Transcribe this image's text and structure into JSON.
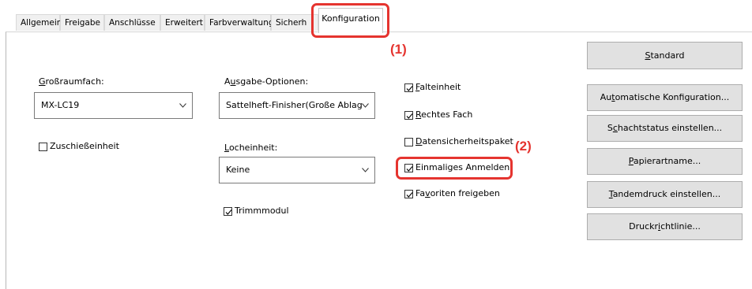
{
  "tabs": [
    "Allgemein",
    "Freigabe",
    "Anschlüsse",
    "Erweitert",
    "Farbverwaltung",
    "Sicherh"
  ],
  "active_tab": "Konfiguration",
  "callouts": {
    "one": "(1)",
    "two": "(2)"
  },
  "grossraumfach": {
    "label_u": "G",
    "label_rest": "roßraumfach:",
    "value": "MX-LC19"
  },
  "zuschiess": {
    "label": "Zuschießeinheit",
    "checked": false
  },
  "ausgabe": {
    "label_pre": "A",
    "label_u": "u",
    "label_rest": "sgabe-Optionen:",
    "value": "Sattelheft-Finisher(Große Ablag"
  },
  "locheinheit": {
    "label_u": "L",
    "label_rest": "ocheinheit:",
    "value": "Keine"
  },
  "trimm": {
    "label": "Trimmmodul",
    "checked": true
  },
  "options": [
    {
      "u": "F",
      "rest": "alteinheit",
      "checked": true
    },
    {
      "u": "R",
      "rest": "echtes Fach",
      "checked": true
    },
    {
      "u": "D",
      "rest": "atensicherheitspaket",
      "checked": false
    },
    {
      "u": "",
      "rest": "Einmaliges Anmelden",
      "checked": true
    },
    {
      "pre": "Fa",
      "u": "v",
      "rest": "oriten freigeben",
      "checked": true
    }
  ],
  "buttons": {
    "standard": {
      "u": "S",
      "rest": "tandard"
    },
    "auto": {
      "pre": "Au",
      "u": "t",
      "rest": "omatische Konfiguration..."
    },
    "schacht": {
      "pre": "S",
      "u": "c",
      "rest": "hachtstatus einstellen..."
    },
    "papier": {
      "u": "P",
      "rest": "apierartname..."
    },
    "tandem": {
      "u": "T",
      "rest": "andemdruck einstellen..."
    },
    "druck": {
      "pre": "Druckr",
      "u": "i",
      "rest": "chtlinie..."
    }
  },
  "colors": {
    "highlight": "#e5342f"
  }
}
